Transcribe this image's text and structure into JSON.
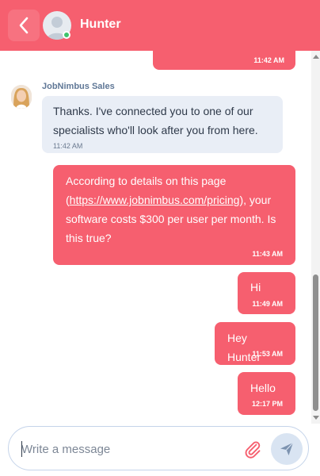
{
  "header": {
    "contact_name": "Hunter",
    "status": "online",
    "icons": {
      "back": "chevron-left-icon",
      "avatar": "user-avatar-icon"
    },
    "color": "#f65f6f"
  },
  "messages": [
    {
      "direction": "outgoing",
      "text": "",
      "time": "11:42 AM"
    },
    {
      "direction": "incoming",
      "sender": "JobNimbus Sales",
      "lines": [
        "Thanks. I've connected you to one of our",
        "specialists who'll look after you from here."
      ],
      "time": "11:42 AM"
    },
    {
      "direction": "outgoing",
      "line1": "According to details on this page",
      "open_paren": "(",
      "link": "https://www.jobnimbus.com/pricing",
      "after_link": "), your",
      "line3": "software costs $300 per user per month. Is",
      "line4": "this true?",
      "time": "11:43 AM"
    },
    {
      "direction": "outgoing",
      "text": "Hi",
      "time": "11:49 AM"
    },
    {
      "direction": "outgoing",
      "text": "Hey Hunter",
      "time": "11:53 AM"
    },
    {
      "direction": "outgoing",
      "text": "Hello",
      "time": "12:17 PM"
    }
  ],
  "composer": {
    "placeholder": "Write a message",
    "value": "",
    "icons": {
      "attach": "paperclip-icon",
      "send": "send-icon"
    }
  },
  "colors": {
    "outgoing_bubble": "#f65f6f",
    "incoming_bubble": "#e9eef6",
    "send_button": "#d9e4f2"
  }
}
